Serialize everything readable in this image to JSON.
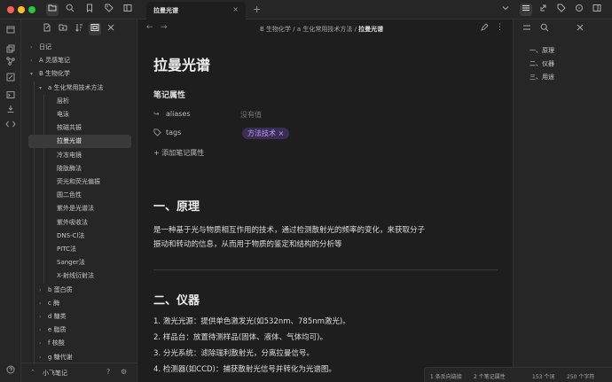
{
  "window": {
    "traffic_colors": [
      "#ff5f57",
      "#febc2e",
      "#28c840"
    ],
    "icons": [
      "folder-icon",
      "search-icon",
      "bookmark-icon",
      "tag-icon",
      "sidebar-toggle-icon"
    ]
  },
  "ribbon": {
    "icons": [
      "calendar-icon",
      "copy-icon",
      "graph-icon",
      "canvas-icon",
      "terminal-icon",
      "import-icon",
      "code-icon"
    ]
  },
  "sidebar": {
    "toolbar_icons": [
      "new-note-icon",
      "new-folder-icon",
      "sort-icon",
      "collapse-icon",
      "close-icon"
    ],
    "tree": [
      {
        "label": "日记",
        "level": 0,
        "expanded": false
      },
      {
        "label": "A 灵感笔记",
        "level": 0,
        "expanded": false
      },
      {
        "label": "B 生物化学",
        "level": 0,
        "expanded": true
      },
      {
        "label": "a 生化常用技术方法",
        "level": 1,
        "expanded": true
      },
      {
        "label": "层析",
        "level": 2
      },
      {
        "label": "电泳",
        "level": 2
      },
      {
        "label": "核磁共振",
        "level": 2
      },
      {
        "label": "拉曼光谱",
        "level": 2,
        "selected": true
      },
      {
        "label": "冷冻电镜",
        "level": 2
      },
      {
        "label": "陵肽酶法",
        "level": 2
      },
      {
        "label": "荧光和荧光偏振",
        "level": 2
      },
      {
        "label": "圆二色性",
        "level": 2
      },
      {
        "label": "紫外是光谱法",
        "level": 2
      },
      {
        "label": "紫外吸收法",
        "level": 2
      },
      {
        "label": "DNS-Cl法",
        "level": 2
      },
      {
        "label": "PITC法",
        "level": 2
      },
      {
        "label": "Sanger法",
        "level": 2
      },
      {
        "label": "X-射线衍射法",
        "level": 2
      },
      {
        "label": "b 蛋白质",
        "level": 1,
        "expanded": false
      },
      {
        "label": "c 酶",
        "level": 1,
        "expanded": false
      },
      {
        "label": "d 糖类",
        "level": 1,
        "expanded": false
      },
      {
        "label": "e 脂质",
        "level": 1,
        "expanded": false
      },
      {
        "label": "f 核酸",
        "level": 1,
        "expanded": false
      },
      {
        "label": "g 糖代谢",
        "level": 1,
        "expanded": false
      }
    ],
    "vault_name": "小飞笔记"
  },
  "tab": {
    "title": "拉曼光谱",
    "close": "×",
    "add": "+"
  },
  "breadcrumb": {
    "part1": "B 生物化学",
    "sep": " / ",
    "part2": "a 生化常用技术方法",
    "current": "拉曼光谱"
  },
  "note": {
    "title": "拉曼光谱",
    "properties_heading": "笔记属性",
    "aliases_key": "aliases",
    "aliases_value": "没有值",
    "tags_key": "tags",
    "tag_value": "方法技术",
    "tag_remove": "×",
    "add_property": "添加笔记属性",
    "h_principle": "一、原理",
    "principle_line1": "是一种基于光与物质相互作用的技术，通过检测散射光的频率的变化，来获取分子",
    "principle_line2": "振动和转动的信息，从而用于物质的鉴定和结构的分析等",
    "h_instrument": "二、仪器",
    "instrument_items": [
      "激光光源：提供单色激发光(如532nm、785nm激光)。",
      "样品台：放置待测样品(固体、液体、气体均可)。",
      "分光系统：滤除瑞利散射光，分离拉曼信号。",
      "检测器(如CCD)：捕获散射光信号并转化为光谱图。"
    ]
  },
  "status": {
    "backlinks": "1 条反向链接",
    "properties": "2 个笔记属性",
    "words": "153 个词",
    "chars": "250 个字符"
  },
  "outline": {
    "items": [
      "一、原理",
      "二、仪器",
      "三、用途"
    ]
  }
}
